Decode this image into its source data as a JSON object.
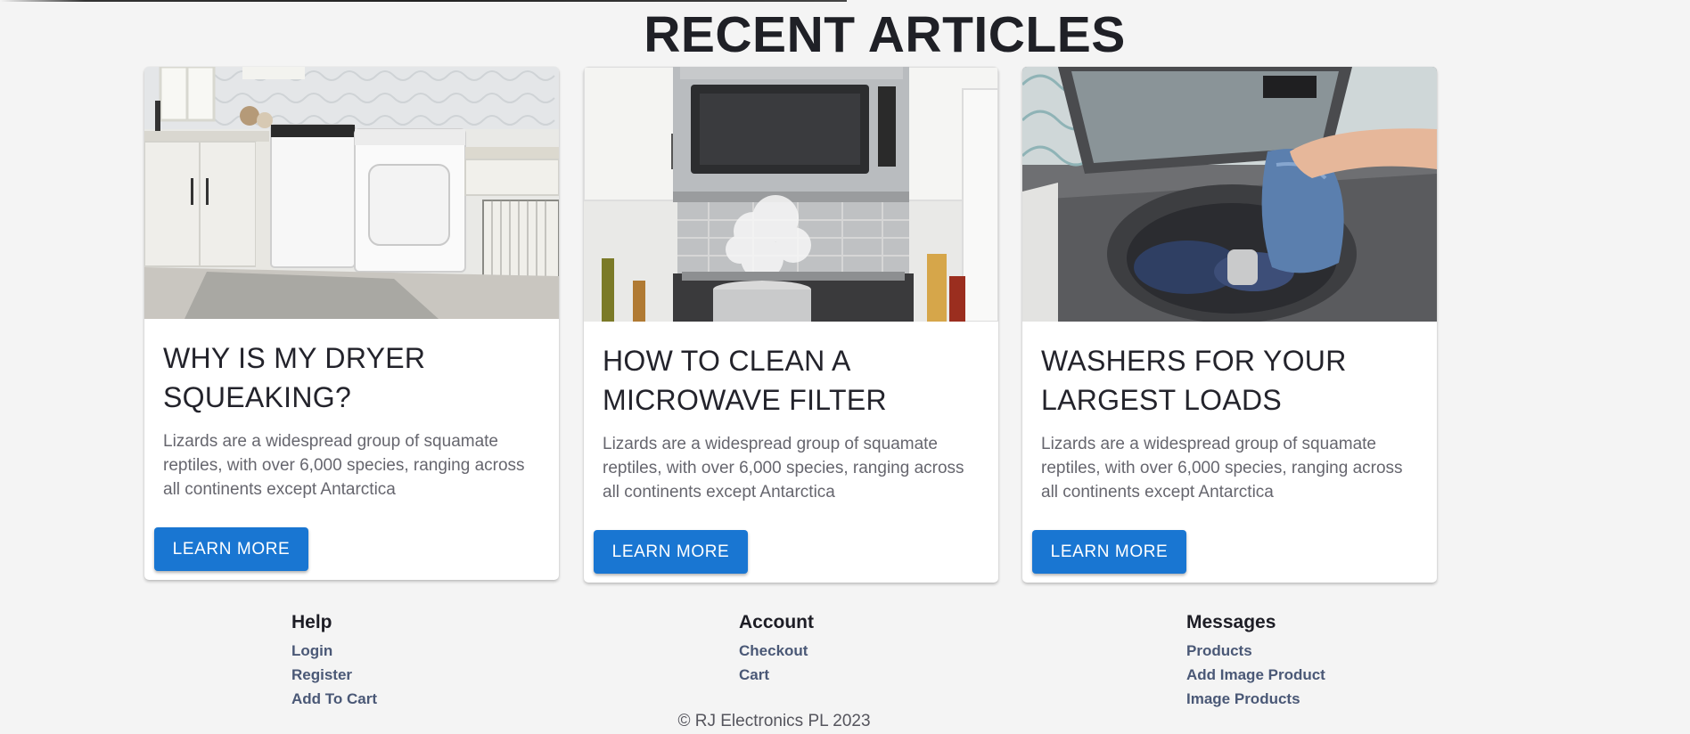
{
  "page": {
    "title": "RECENT ARTICLES"
  },
  "articles": [
    {
      "title": "WHY IS MY DRYER SQUEAKING?",
      "text": "Lizards are a widespread group of squamate reptiles, with over 6,000 species, ranging across all continents except Antarctica",
      "button": "LEARN MORE",
      "image": "laundry-room-washer-dryer"
    },
    {
      "title": "HOW TO CLEAN A MICROWAVE FILTER",
      "text": "Lizards are a widespread group of squamate reptiles, with over 6,000 species, ranging across all continents except Antarctica",
      "button": "LEARN MORE",
      "image": "over-range-microwave-steaming-pot"
    },
    {
      "title": "WASHERS FOR YOUR LARGEST LOADS",
      "text": "Lizards are a widespread group of squamate reptiles, with over 6,000 species, ranging across all continents except Antarctica",
      "button": "LEARN MORE",
      "image": "top-load-washer-with-towel"
    }
  ],
  "footer": {
    "columns": [
      {
        "heading": "Help",
        "links": [
          "Login",
          "Register",
          "Add To Cart"
        ]
      },
      {
        "heading": "Account",
        "links": [
          "Checkout",
          "Cart"
        ]
      },
      {
        "heading": "Messages",
        "links": [
          "Products",
          "Add Image Product",
          "Image Products"
        ]
      }
    ],
    "copyright": "© RJ Electronics PL 2023"
  },
  "colors": {
    "background": "#f4f4f4",
    "button": "#1976d2",
    "link": "#4a5876"
  }
}
